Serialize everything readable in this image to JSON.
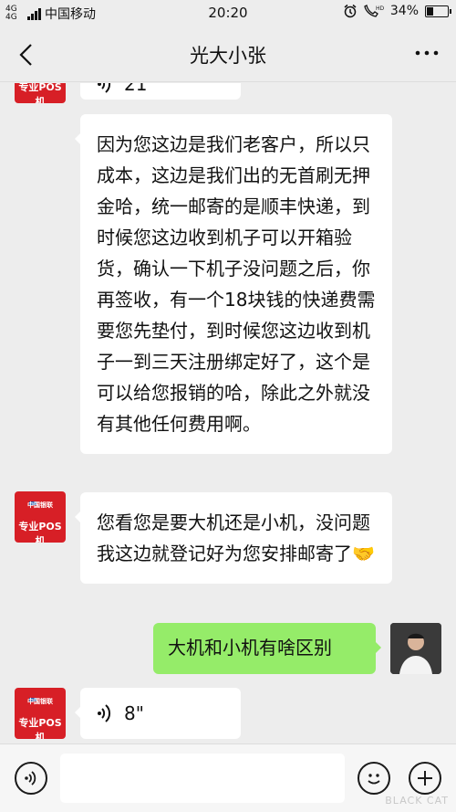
{
  "status_bar": {
    "network": "4G 4G",
    "carrier": "中国移动",
    "time": "20:20",
    "battery_text": "34%",
    "battery_level": 0.34
  },
  "header": {
    "title": "光大小张"
  },
  "avatars": {
    "contact_label": "专业POS机",
    "contact_brand": "中国银联"
  },
  "messages": [
    {
      "from": "contact",
      "type": "voice",
      "duration": "21\""
    },
    {
      "from": "contact",
      "type": "text",
      "text": "因为您这边是我们老客户，所以只成本，这边是我们出的无首刷无押金哈，统一邮寄的是顺丰快递，到时候您这边收到机子可以开箱验货，确认一下机子没问题之后，你再签收，有一个18块钱的快递费需要您先垫付，到时候您这边收到机子一到三天注册绑定好了，这个是可以给您报销的哈，除此之外就没有其他任何费用啊。"
    },
    {
      "from": "contact",
      "type": "text",
      "text": "您看您是要大机还是小机，没问题我这边就登记好为您安排邮寄了🤝"
    },
    {
      "from": "me",
      "type": "text",
      "text": "大机和小机有啥区别"
    },
    {
      "from": "contact",
      "type": "voice",
      "duration": "8\""
    }
  ],
  "watermark": {
    "text": "BLACK CAT"
  },
  "colors": {
    "background": "#ededed",
    "bubble_incoming": "#ffffff",
    "bubble_outgoing": "#95ec69",
    "avatar_red": "#d71f26"
  }
}
